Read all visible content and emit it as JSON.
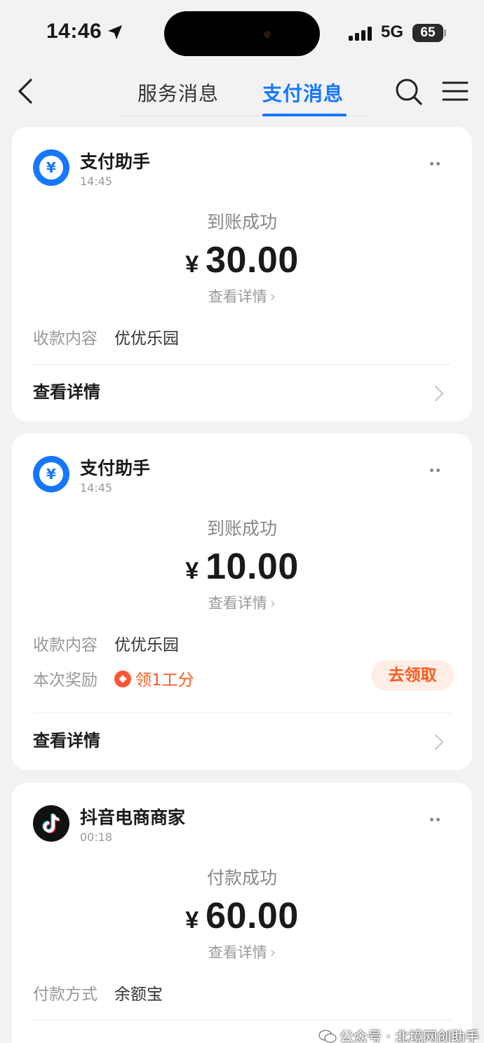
{
  "status_bar": {
    "time": "14:46",
    "network": "5G",
    "battery": "65"
  },
  "nav": {
    "tabs": [
      {
        "label": "服务消息",
        "active": false
      },
      {
        "label": "支付消息",
        "active": true
      }
    ],
    "accent_color": "#1677ff"
  },
  "messages": [
    {
      "sender": "支付助手",
      "time": "14:45",
      "avatar_icon": "yuan-bubble-icon",
      "status": "到账成功",
      "currency": "¥",
      "amount": "30.00",
      "view_link": "查看详情",
      "rows": [
        {
          "label": "收款内容",
          "value": "优优乐园"
        }
      ],
      "detail_label": "查看详情"
    },
    {
      "sender": "支付助手",
      "time": "14:45",
      "avatar_icon": "yuan-bubble-icon",
      "status": "到账成功",
      "currency": "¥",
      "amount": "10.00",
      "view_link": "查看详情",
      "rows": [
        {
          "label": "收款内容",
          "value": "优优乐园"
        },
        {
          "label": "本次奖励",
          "value": "领1工分"
        }
      ],
      "claim_button": "去领取",
      "detail_label": "查看详情"
    },
    {
      "sender": "抖音电商商家",
      "time": "00:18",
      "avatar_icon": "douyin-logo-icon",
      "status": "付款成功",
      "currency": "¥",
      "amount": "60.00",
      "view_link": "查看详情",
      "rows": [
        {
          "label": "付款方式",
          "value": "余额宝"
        }
      ]
    }
  ],
  "watermark": "公众号 · 北境网创助手"
}
